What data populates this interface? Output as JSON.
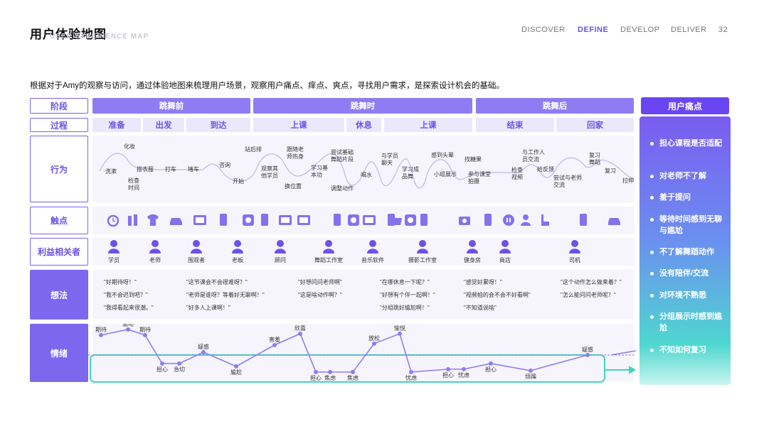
{
  "header": {
    "title": "用户体验地图",
    "subtitle": "USER EXPERIENCE MAP",
    "nav": [
      "DISCOVER",
      "DEFINE",
      "DEVELOP",
      "DELIVER"
    ],
    "page_number": "32"
  },
  "intro": "根据对于Amy的观察与访问，通过体验地图来梳理用户场景，观察用户痛点、痒点、爽点，寻找用户需求，是探索设计机会的基础。",
  "row_labels": {
    "stage": "阶段",
    "process": "过程",
    "behavior": "行为",
    "touchpoint": "触点",
    "stakeholder": "利益相关者",
    "thoughts": "想法",
    "emotion": "情绪"
  },
  "stages": [
    "跳舞前",
    "跳舞时",
    "跳舞后"
  ],
  "processes": [
    "准备",
    "出发",
    "到达",
    "上课",
    "休息",
    "上课",
    "结束",
    "回家"
  ],
  "behaviors": [
    "化妆",
    "洗漱",
    "检查时间",
    "搭衣服",
    "打车",
    "堵车",
    "咨询",
    "站后排",
    "开始",
    "观察其他学员",
    "跟随老师热身",
    "换位置",
    "学习基本功",
    "尝试基础舞蹈片段",
    "调整动作",
    "喝水",
    "与学员聊天",
    "学习成品舞",
    "感到头晕",
    "小组展示",
    "找糖果",
    "参与课堂拍摄",
    "检查视频",
    "与工作人员交流",
    "给反馈",
    "尝试与老师交流",
    "复习舞蹈",
    "复习",
    "拉伸"
  ],
  "stakeholders": [
    "学员",
    "老师",
    "围观者",
    "老板",
    "顾问",
    "舞蹈工作室",
    "音乐软件",
    "摄影工作室",
    "健身房",
    "商店",
    "司机"
  ],
  "thoughts": [
    "\"好期待呀！\"",
    "\"我不会迟到吧？\"",
    "\"我得看起来很潮。\"",
    "\"这节课会不会很难呀？\"",
    "\"老师是谁呀？等着好无聊啊！\"",
    "\"好多人上课啊！\"",
    "\"好想问问老师啊\"",
    "\"这是啥动作啊？\"",
    "\"在哪休息一下呢？\"",
    "\"好想有个伴一起啊！\"",
    "\"分组跳好尴尬啊！\"",
    "\"感觉好累呀！\"",
    "\"视频拍的会不会不好看啊\"",
    "\"不知道说啥\"",
    "\"这个动作怎么做来着？\"",
    "\"怎么能问问老师呢？\""
  ],
  "emotions": [
    "期待",
    "激动",
    "期待",
    "担心",
    "急切",
    "疑惑",
    "尴尬",
    "害羞",
    "欣喜",
    "担心",
    "焦虑",
    "焦虑",
    "放松",
    "愉悦",
    "忧虑",
    "担心",
    "忧虑",
    "担心",
    "烦躁",
    "疑惑"
  ],
  "pain_panel": {
    "title": "用户痛点",
    "items": [
      "担心课程是否适配",
      "对老师不了解",
      "羞于提问",
      "等待时间感到无聊与尴尬",
      "不了解舞蹈动作",
      "没有陪伴/交流",
      "对环境不熟悉",
      "分组展示时感到尴尬",
      "不知如何复习"
    ]
  },
  "colors": {
    "accent": "#6d52e6",
    "stage": "#8f7cf2",
    "teal": "#3ed6c0"
  },
  "touchpoint_icons": [
    "alarm-clock-icon",
    "cosmetics-icon",
    "tshirt-icon",
    "car-icon",
    "tablet-icon",
    "phone-icon",
    "app-icon",
    "phone-icon",
    "tablet-icon",
    "tablet-icon",
    "phone-icon",
    "app-icon",
    "tablet-icon",
    "cup-icon",
    "phone-icon",
    "app-icon",
    "phone-icon",
    "camera-icon",
    "phone-icon",
    "record-icon",
    "person-icon",
    "seat-icon",
    "phone-icon",
    "car-icon"
  ]
}
